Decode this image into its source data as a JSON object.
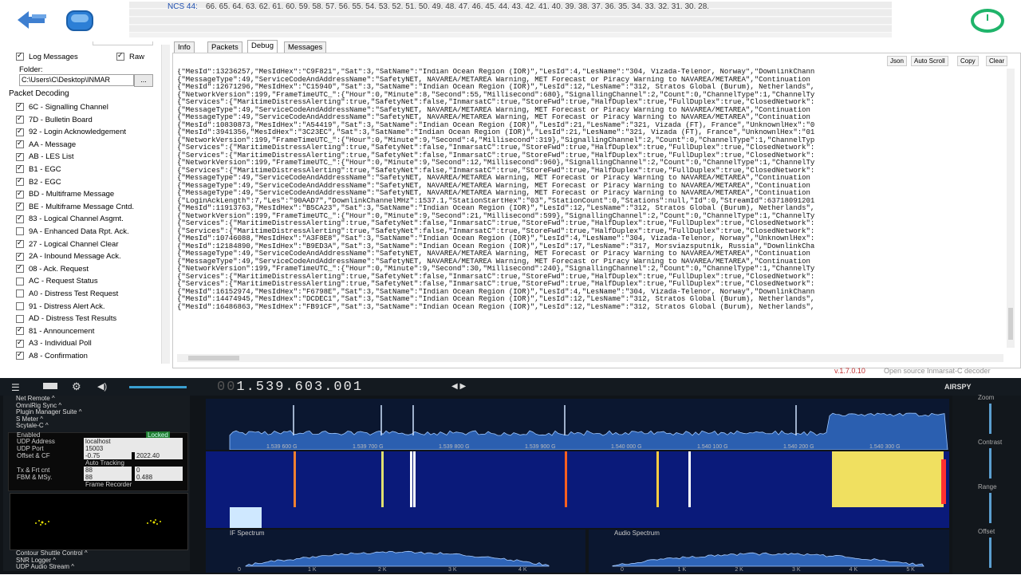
{
  "ncs": {
    "label": "NCS 44:",
    "values": "66. 65. 64. 63. 62. 61. 60. 59. 58. 57. 56. 55. 54. 53. 52. 51. 50. 49. 48. 47. 46. 45. 44. 43. 42. 41. 40. 39. 38. 37. 36. 35. 34. 33. 32. 31. 30. 28."
  },
  "options": {
    "log_messages": "Log Messages",
    "raw": "Raw",
    "folder_label": "Folder:",
    "folder_path": "C:\\Users\\C\\Desktop\\INMAR",
    "browse": "...",
    "packet_decoding": "Packet Decoding"
  },
  "packets": [
    {
      "label": "6C - Signalling Channel",
      "checked": true
    },
    {
      "label": "7D - Bulletin Board",
      "checked": true
    },
    {
      "label": "92 - Login Acknowledgement",
      "checked": true
    },
    {
      "label": "AA - Message",
      "checked": true
    },
    {
      "label": "AB - LES List",
      "checked": true
    },
    {
      "label": "B1 - EGC",
      "checked": true
    },
    {
      "label": "B2 - EGC",
      "checked": true
    },
    {
      "label": "BD - Multiframe Message",
      "checked": true
    },
    {
      "label": "BE - Multiframe Message Cntd.",
      "checked": true
    },
    {
      "label": "83 - Logical Channel Asgmt.",
      "checked": true
    },
    {
      "label": "9A - Enhanced Data Rpt. Ack.",
      "checked": false
    },
    {
      "label": "27 - Logical Channel Clear",
      "checked": true
    },
    {
      "label": "2A - Inbound Message Ack.",
      "checked": true
    },
    {
      "label": "08 - Ack. Request",
      "checked": true
    },
    {
      "label": "AC - Request Status",
      "checked": false
    },
    {
      "label": "A0 - Distress Test Request",
      "checked": false
    },
    {
      "label": "91 - Distress Alert Ack.",
      "checked": false
    },
    {
      "label": "AD - Distress Test Results",
      "checked": false
    },
    {
      "label": "81 - Announcement",
      "checked": true
    },
    {
      "label": "A3 - Individual Poll",
      "checked": true
    },
    {
      "label": "A8 - Confirmation",
      "checked": true
    }
  ],
  "tabs": [
    "Info",
    "Packets",
    "Debug",
    "Messages"
  ],
  "log_toolbar": [
    "Json",
    "Auto Scroll",
    "Copy",
    "Clear"
  ],
  "log_lines": [
    "{\"MesId\":13236257,\"MesIdHex\":\"C9F821\",\"Sat\":3,\"SatName\":\"Indian Ocean Region (IOR)\",\"LesId\":4,\"LesName\":\"304, Vizada-Telenor, Norway\",\"DownlinkChann",
    "{\"MessageType\":49,\"ServiceCodeAndAddressName\":\"SafetyNET, NAVAREA/METAREA Warning, MET Forecast or Piracy Warning to NAVAREA/METAREA\",\"Continuation",
    "{\"MesId\":12671296,\"MesIdHex\":\"C15940\",\"Sat\":3,\"SatName\":\"Indian Ocean Region (IOR)\",\"LesId\":12,\"LesName\":\"312, Stratos Global (Burum), Netherlands\",",
    "{\"NetworkVersion\":199,\"FrameTimeUTC_\":{\"Hour\":0,\"Minute\":8,\"Second\":55,\"Millisecond\":680},\"SignallingChannel\":2,\"Count\":0,\"ChannelType\":1,\"ChannelTy",
    "{\"Services\":{\"MaritimeDistressAlerting\":true,\"SafetyNet\":false,\"InmarsatC\":true,\"StoreFwd\":true,\"HalfDuplex\":true,\"FullDuplex\":true,\"ClosedNetwork\":",
    "{\"MessageType\":49,\"ServiceCodeAndAddressName\":\"SafetyNET, NAVAREA/METAREA Warning, MET Forecast or Piracy Warning to NAVAREA/METAREA\",\"Continuation",
    "{\"MessageType\":49,\"ServiceCodeAndAddressName\":\"SafetyNET, NAVAREA/METAREA Warning, MET Forecast or Piracy Warning to NAVAREA/METAREA\",\"Continuation",
    "{\"MesId\":10830873,\"MesIdHex\":\"A54419\",\"Sat\":3,\"SatName\":\"Indian Ocean Region (IOR)\",\"LesId\":21,\"LesName\":\"321, Vizada (FT), France\",\"UnknownlHex\":\"0",
    "{\"MesId\":3941356,\"MesIdHex\":\"3C23EC\",\"Sat\":3,\"SatName\":\"Indian Ocean Region (IOR)\",\"LesId\":21,\"LesName\":\"321, Vizada (FT), France\",\"UnknownlHex\":\"01",
    "{\"NetworkVersion\":199,\"FrameTimeUTC_\":{\"Hour\":0,\"Minute\":9,\"Second\":4,\"Millisecond\":319},\"SignallingChannel\":2,\"Count\":0,\"ChannelType\":1,\"ChannelTyp",
    "{\"Services\":{\"MaritimeDistressAlerting\":true,\"SafetyNet\":false,\"InmarsatC\":true,\"StoreFwd\":true,\"HalfDuplex\":true,\"FullDuplex\":true,\"ClosedNetwork\":",
    "{\"Services\":{\"MaritimeDistressAlerting\":true,\"SafetyNet\":false,\"InmarsatC\":true,\"StoreFwd\":true,\"HalfDuplex\":true,\"FullDuplex\":true,\"ClosedNetwork\":",
    "{\"NetworkVersion\":199,\"FrameTimeUTC_\":{\"Hour\":0,\"Minute\":9,\"Second\":12,\"Millisecond\":960},\"SignallingChannel\":2,\"Count\":0,\"ChannelType\":1,\"ChannelTy",
    "{\"Services\":{\"MaritimeDistressAlerting\":true,\"SafetyNet\":false,\"InmarsatC\":true,\"StoreFwd\":true,\"HalfDuplex\":true,\"FullDuplex\":true,\"ClosedNetwork\":",
    "{\"MessageType\":49,\"ServiceCodeAndAddressName\":\"SafetyNET, NAVAREA/METAREA Warning, MET Forecast or Piracy Warning to NAVAREA/METAREA\",\"Continuation",
    "{\"MessageType\":49,\"ServiceCodeAndAddressName\":\"SafetyNET, NAVAREA/METAREA Warning, MET Forecast or Piracy Warning to NAVAREA/METAREA\",\"Continuation",
    "{\"MessageType\":49,\"ServiceCodeAndAddressName\":\"SafetyNET, NAVAREA/METAREA Warning, MET Forecast or Piracy Warning to NAVAREA/METAREA\",\"Continuation",
    "{\"LoginAckLength\":7,\"Les\":\"90AAD7\",\"DownlinkChannelMHz\":1537.1,\"StationStartHex\":\"03\",\"StationCount\":0,\"Stations\":null,\"Id\":0,\"StreamId\":63718091201",
    "{\"MesId\":11913763,\"MesIdHex\":\"B5CA23\",\"Sat\":3,\"SatName\":\"Indian Ocean Region (IOR)\",\"LesId\":12,\"LesName\":\"312, Stratos Global (Burum), Netherlands\",",
    "{\"NetworkVersion\":199,\"FrameTimeUTC_\":{\"Hour\":0,\"Minute\":9,\"Second\":21,\"Millisecond\":599},\"SignallingChannel\":2,\"Count\":0,\"ChannelType\":1,\"ChannelTy",
    "{\"Services\":{\"MaritimeDistressAlerting\":true,\"SafetyNet\":false,\"InmarsatC\":true,\"StoreFwd\":true,\"HalfDuplex\":true,\"FullDuplex\":true,\"ClosedNetwork\":",
    "{\"Services\":{\"MaritimeDistressAlerting\":true,\"SafetyNet\":false,\"InmarsatC\":true,\"StoreFwd\":true,\"HalfDuplex\":true,\"FullDuplex\":true,\"ClosedNetwork\":",
    "{\"MesId\":10746088,\"MesIdHex\":\"A3F8E8\",\"Sat\":3,\"SatName\":\"Indian Ocean Region (IOR)\",\"LesId\":4,\"LesName\":\"304, Vizada-Telenor, Norway\",\"UnknownlHex\":",
    "{\"MesId\":12184890,\"MesIdHex\":\"B9ED3A\",\"Sat\":3,\"SatName\":\"Indian Ocean Region (IOR)\",\"LesId\":17,\"LesName\":\"317, Morsviazsputnik, Russia\",\"DownlinkCha",
    "{\"MessageType\":49,\"ServiceCodeAndAddressName\":\"SafetyNET, NAVAREA/METAREA Warning, MET Forecast or Piracy Warning to NAVAREA/METAREA\",\"Continuation",
    "{\"MessageType\":49,\"ServiceCodeAndAddressName\":\"SafetyNET, NAVAREA/METAREA Warning, MET Forecast or Piracy Warning to NAVAREA/METAREA\",\"Continuation",
    "{\"NetworkVersion\":199,\"FrameTimeUTC_\":{\"Hour\":0,\"Minute\":9,\"Second\":30,\"Millisecond\":240},\"SignallingChannel\":2,\"Count\":0,\"ChannelType\":1,\"ChannelTy",
    "{\"Services\":{\"MaritimeDistressAlerting\":true,\"SafetyNet\":false,\"InmarsatC\":true,\"StoreFwd\":true,\"HalfDuplex\":true,\"FullDuplex\":true,\"ClosedNetwork\":",
    "{\"Services\":{\"MaritimeDistressAlerting\":true,\"SafetyNet\":false,\"InmarsatC\":true,\"StoreFwd\":true,\"HalfDuplex\":true,\"FullDuplex\":true,\"ClosedNetwork\":",
    "{\"MesId\":16152974,\"MesIdHex\":\"F6798E\",\"Sat\":3,\"SatName\":\"Indian Ocean Region (IOR)\",\"LesId\":4,\"LesName\":\"304, Vizada-Telenor, Norway\",\"DownlinkChann",
    "{\"MesId\":14474945,\"MesIdHex\":\"DCDEC1\",\"Sat\":3,\"SatName\":\"Indian Ocean Region (IOR)\",\"LesId\":12,\"LesName\":\"312, Stratos Global (Burum), Netherlands\",",
    "{\"MesId\":16486863,\"MesIdHex\":\"FB91CF\",\"Sat\":3,\"SatName\":\"Indian Ocean Region (IOR)\",\"LesId\":12,\"LesName\":\"312, Stratos Global (Burum), Netherlands\","
  ],
  "version": "v.1.7.0.10",
  "open_source": "Open source Inmarsat-C decoder",
  "sdr": {
    "frequency_dim": "00",
    "frequency": "1.539.603.001",
    "brand": "AIRSPY",
    "side_items_top": [
      "Net Remote ^",
      "OmniRig Sync ^",
      "Plugin Manager Suite ^",
      "S Meter ^",
      "Scytale-C ^"
    ],
    "side_items_bottom": [
      "Contour Shuttle Control ^",
      "SNR Logger ^",
      "UDP Audio Stream ^"
    ],
    "decoder": {
      "enabled_label": "Enabled",
      "locked_badge": "Locked",
      "udp_address_label": "UDP Address",
      "udp_address": "localhost",
      "udp_port_label": "UDP Port",
      "udp_port": "15003",
      "offset_label": "Offset & CF",
      "offset": "-0.75",
      "cf": "2022.40",
      "auto_tracking": "Auto Tracking",
      "tx_label": "Tx & Frt cnt",
      "tx": "88",
      "frt": "0",
      "fbm_label": "FBM & MSy.",
      "fbm": "88",
      "msy": "0.488",
      "frame_recorder": "Frame Recorder"
    },
    "freq_ticks": [
      "1.539 600 G",
      "1.539 700 G",
      "1.539 800 G",
      "1.539 900 G",
      "1.540 000 G",
      "1.540 100 G",
      "1.540 200 G",
      "1.540 300 G"
    ],
    "if_title": "IF Spectrum",
    "if_ticks": [
      "0",
      "1 K",
      "2 K",
      "3 K",
      "4 K"
    ],
    "audio_title": "Audio Spectrum",
    "audio_ticks": [
      "0",
      "1 K",
      "2 K",
      "3 K",
      "4 K",
      "5 K"
    ],
    "right_labels": [
      "Zoom",
      "Contrast",
      "Range",
      "Offset"
    ]
  }
}
